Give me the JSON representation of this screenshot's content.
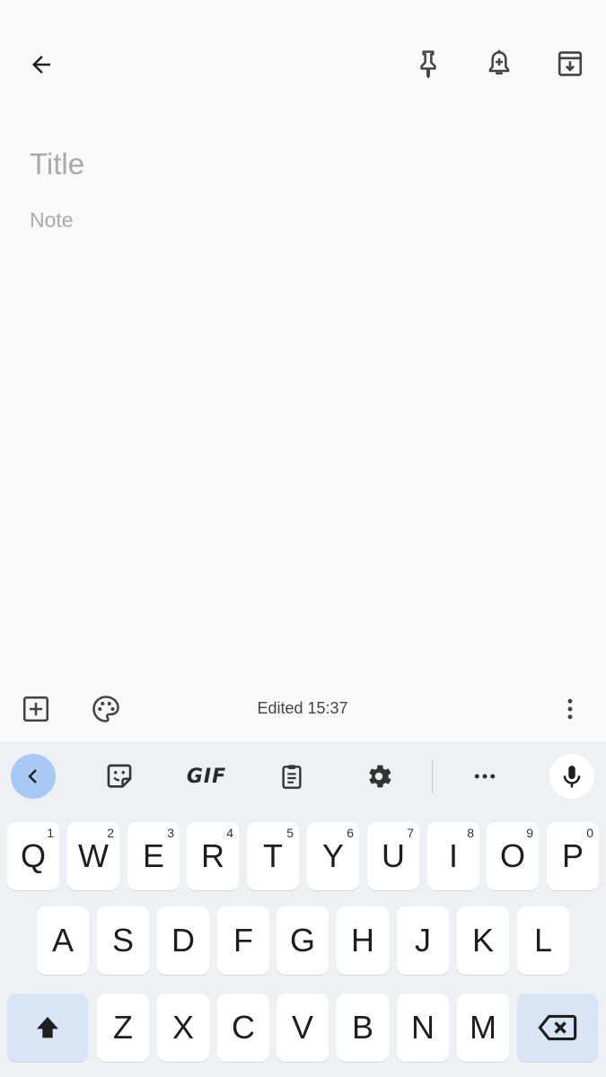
{
  "editor": {
    "title_placeholder": "Title",
    "note_placeholder": "Note",
    "edited": "Edited 15:37"
  },
  "icons": {
    "back": "arrow-left-icon",
    "pin": "pin-icon",
    "reminder": "add-alert-icon",
    "archive": "archive-icon",
    "add": "add-box-icon",
    "palette": "palette-icon",
    "more": "more-vert-icon"
  },
  "keyboard": {
    "toolbar": {
      "gif_label": "GIF"
    },
    "row1": [
      {
        "key": "Q",
        "num": "1"
      },
      {
        "key": "W",
        "num": "2"
      },
      {
        "key": "E",
        "num": "3"
      },
      {
        "key": "R",
        "num": "4"
      },
      {
        "key": "T",
        "num": "5"
      },
      {
        "key": "Y",
        "num": "6"
      },
      {
        "key": "U",
        "num": "7"
      },
      {
        "key": "I",
        "num": "8"
      },
      {
        "key": "O",
        "num": "9"
      },
      {
        "key": "P",
        "num": "0"
      }
    ],
    "row2": [
      "A",
      "S",
      "D",
      "F",
      "G",
      "H",
      "J",
      "K",
      "L"
    ],
    "row3": [
      "Z",
      "X",
      "C",
      "V",
      "B",
      "N",
      "M"
    ]
  },
  "colors": {
    "background": "#f9f9f9",
    "keyboard_bg": "#eef0f4",
    "key_bg": "#ffffff",
    "modifier_key_bg": "#d9e4f4",
    "collapse_button_bg": "#a8c8f5",
    "placeholder": "#a9a9a9"
  }
}
